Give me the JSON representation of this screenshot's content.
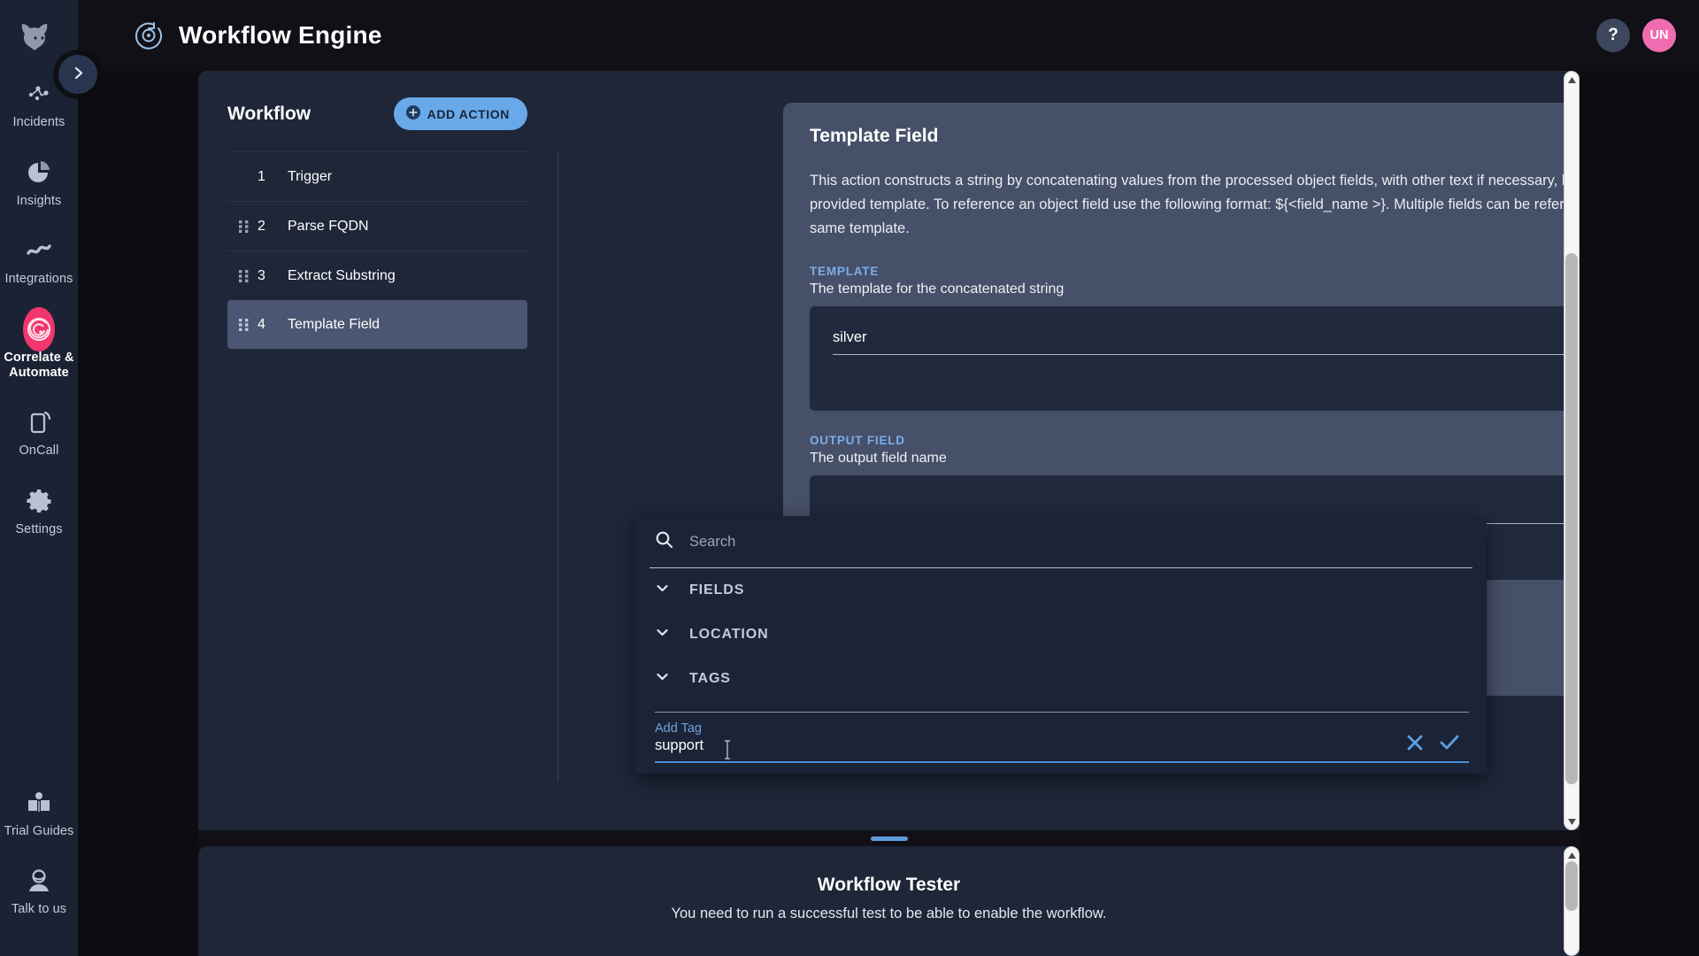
{
  "brand": {
    "accent": "#f2376e",
    "primary_blue": "#6aa9e9",
    "label_blue": "#79aeea"
  },
  "rail": {
    "logo_icon": "bull-logo-icon",
    "items": [
      {
        "label": "Incidents",
        "icon": "incidents-icon",
        "active": false
      },
      {
        "label": "Insights",
        "icon": "pie-chart-icon",
        "active": false
      },
      {
        "label": "Integrations",
        "icon": "integrations-icon",
        "active": false
      },
      {
        "label": "Correlate & Automate",
        "icon": "target-icon",
        "active": true
      },
      {
        "label": "OnCall",
        "icon": "mobile-icon",
        "active": false
      },
      {
        "label": "Settings",
        "icon": "gear-icon",
        "active": false
      }
    ],
    "bottom_items": [
      {
        "label": "Trial Guides",
        "icon": "book-icon"
      },
      {
        "label": "Talk to us",
        "icon": "support-agent-icon"
      }
    ],
    "collapse_icon": "chevron-right-icon"
  },
  "topbar": {
    "logo_icon": "workflow-engine-icon",
    "title": "Workflow Engine",
    "help_label": "?",
    "avatar_initials": "UN"
  },
  "workflow": {
    "panel_title": "Workflow",
    "add_action_label": "ADD ACTION",
    "add_action_icon": "plus-circle-icon",
    "steps": [
      {
        "number": "1",
        "name": "Trigger",
        "draggable": false,
        "selected": false
      },
      {
        "number": "2",
        "name": "Parse FQDN",
        "draggable": true,
        "selected": false
      },
      {
        "number": "3",
        "name": "Extract Substring",
        "draggable": true,
        "selected": false
      },
      {
        "number": "4",
        "name": "Template Field",
        "draggable": true,
        "selected": true
      }
    ]
  },
  "action_card": {
    "title": "Template Field",
    "delete_icon": "trash-icon",
    "description": "This action constructs a string by concatenating values from the processed object fields, with other text if necessary, based on the provided template. To reference an object field use the following format: ${<field_name >}. Multiple fields can be referenced in the same template.",
    "template_field": {
      "label": "TEMPLATE",
      "hint": "The template for the concatenated string",
      "value": "silver",
      "placeholder": ""
    },
    "output_field": {
      "label": "OUTPUT FIELD",
      "hint": "The output field name",
      "value": "",
      "placeholder": ""
    }
  },
  "dropdown": {
    "search_icon": "search-icon",
    "search_value": "",
    "search_placeholder": "Search",
    "groups": [
      {
        "label": "FIELDS",
        "icon": "chevron-down-icon"
      },
      {
        "label": "LOCATION",
        "icon": "chevron-down-icon"
      },
      {
        "label": "TAGS",
        "icon": "chevron-down-icon"
      }
    ],
    "add_tag": {
      "label": "Add Tag",
      "value": "support",
      "placeholder": "",
      "cancel_icon": "close-icon",
      "confirm_icon": "check-icon"
    }
  },
  "tester": {
    "title": "Workflow Tester",
    "subtitle": "You need to run a successful test to be able to enable the workflow.",
    "drag_handle": "resize-handle"
  }
}
